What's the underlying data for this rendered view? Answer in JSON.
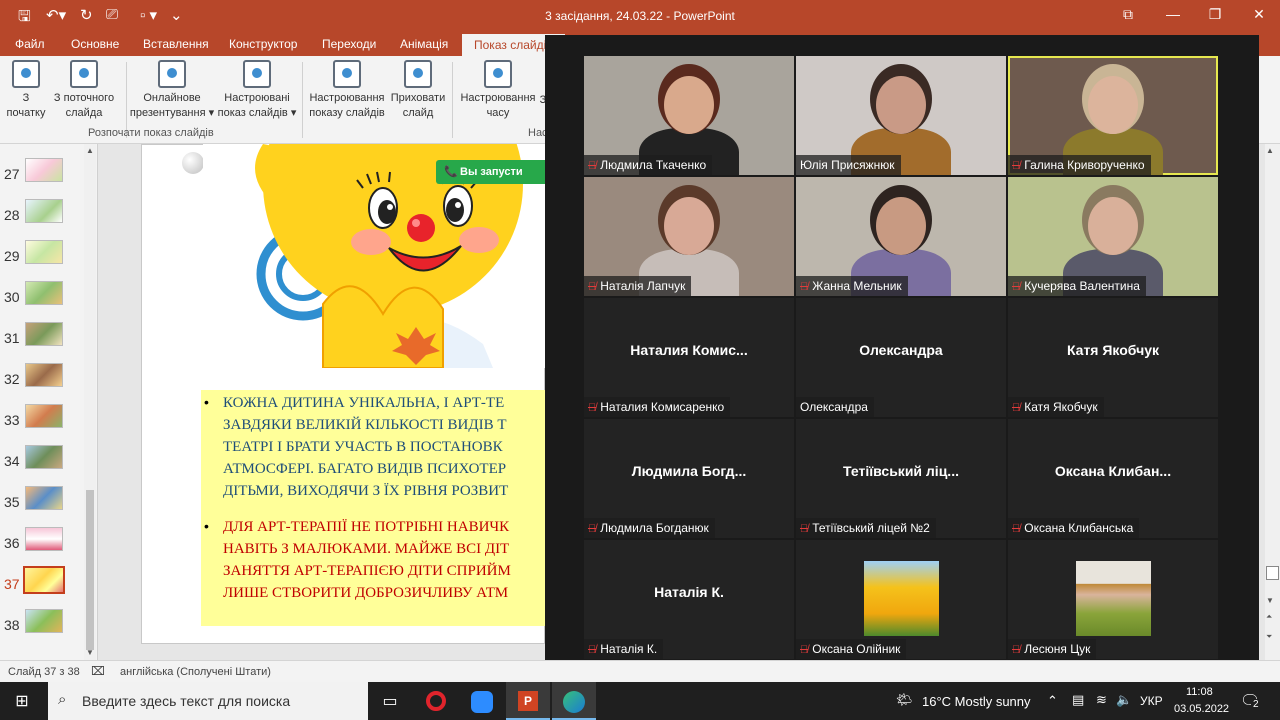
{
  "titlebar": {
    "title": "3 засідання, 24.03.22 - PowerPoint",
    "min": "—",
    "max": "❐",
    "close": "✕",
    "restore": "⧉"
  },
  "ribbon_tabs": [
    "Файл",
    "Основне",
    "Вставлення",
    "Конструктор",
    "Переходи",
    "Анімація",
    "Показ слайдів"
  ],
  "ribbon": {
    "buttons": [
      {
        "line1": "З",
        "line2": "початку"
      },
      {
        "line1": "З поточного",
        "line2": "слайда"
      },
      {
        "line1": "Онлайнове",
        "line2": "презентування ▾"
      },
      {
        "line1": "Настроювані",
        "line2": "показ слайдів ▾"
      },
      {
        "line1": "Настроювання",
        "line2": "показу слайдів"
      },
      {
        "line1": "Приховати",
        "line2": "слайд"
      },
      {
        "line1": "Настроювання",
        "line2": "часу"
      },
      {
        "line1": "З",
        "line2": ""
      }
    ],
    "group1": "Розпочати показ слайдів",
    "group2": "Нас"
  },
  "thumbnails": [
    {
      "num": "27"
    },
    {
      "num": "28"
    },
    {
      "num": "29"
    },
    {
      "num": "30"
    },
    {
      "num": "31"
    },
    {
      "num": "32"
    },
    {
      "num": "33"
    },
    {
      "num": "34"
    },
    {
      "num": "35"
    },
    {
      "num": "36"
    },
    {
      "num": "37"
    },
    {
      "num": "38"
    }
  ],
  "slide": {
    "notice": "Вы запусти",
    "bullets_blue": [
      "КОЖНА ДИТИНА УНІКАЛЬНА, І АРТ-ТЕ",
      "ЗАВДЯКИ ВЕЛИКІЙ КІЛЬКОСТІ ВИДІВ Т",
      "ТЕАТРІ І БРАТИ УЧАСТЬ В ПОСТАНОВК",
      "АТМОСФЕРІ. БАГАТО ВИДІВ ПСИХОТЕР",
      "ДІТЬМИ, ВИХОДЯЧИ З ЇХ РІВНЯ РОЗВИТ"
    ],
    "bullets_red": [
      "ДЛЯ АРТ-ТЕРАПІЇ НЕ ПОТРІБНІ НАВИЧК",
      "НАВІТЬ З МАЛЮКАМИ. МАЙЖЕ ВСІ ДІТ",
      "ЗАНЯТТЯ АРТ-ТЕРАПІЄЮ ДІТИ СПРИЙМ",
      "ЛИШЕ СТВОРИТИ ДОБРОЗИЧЛИВУ АТМ"
    ]
  },
  "zoom": {
    "participants": [
      {
        "name": "Людмила Ткаченко",
        "mic_muted": true,
        "video": true,
        "skin": "#d9a98c",
        "hair": "#5a2a1e",
        "shirt": "#222",
        "bg": "#a9a49c"
      },
      {
        "name": "Юлія Присяжнюк",
        "mic_muted": false,
        "video": true,
        "skin": "#c99a86",
        "hair": "#3a2a24",
        "shirt": "#a26c2c",
        "bg": "#cfc9c6"
      },
      {
        "name": "Галина Криворученко",
        "mic_muted": true,
        "video": true,
        "skin": "#dcb49c",
        "hair": "#c9b595",
        "shirt": "#8c7a2c",
        "bg": "#6e5a4e"
      },
      {
        "name": "Наталія Лапчук",
        "mic_muted": true,
        "video": true,
        "skin": "#d8a996",
        "hair": "#5b3a2a",
        "shirt": "#c6bdb8",
        "bg": "#9a8a7e"
      },
      {
        "name": "Жанна Мельник",
        "mic_muted": true,
        "video": true,
        "skin": "#c89a82",
        "hair": "#2e2420",
        "shirt": "#7b6fa0",
        "bg": "#bdb7ad"
      },
      {
        "name": "Кучерява Валентина",
        "mic_muted": true,
        "video": true,
        "skin": "#d9b09a",
        "hair": "#8a7a60",
        "shirt": "#5a5a6a",
        "bg": "#b9c28e"
      },
      {
        "name": "Наталия Комисаренко",
        "display": "Наталия  Комис...",
        "mic_muted": true,
        "video": false
      },
      {
        "name": "Олександра",
        "display": "Олександра",
        "mic_muted": false,
        "video": false
      },
      {
        "name": "Катя Якобчук",
        "display": "Катя Якобчук",
        "mic_muted": true,
        "video": false
      },
      {
        "name": "Людмила Богданюк",
        "display": "Людмила  Богд...",
        "mic_muted": true,
        "video": false
      },
      {
        "name": "Тетіївський ліцей №2",
        "display": "Тетіївський  ліц...",
        "mic_muted": true,
        "video": false
      },
      {
        "name": "Оксана Клибанська",
        "display": "Оксана  Клибан...",
        "mic_muted": true,
        "video": false
      },
      {
        "name": "Наталія К.",
        "display": "Наталія К.",
        "mic_muted": true,
        "video": false
      },
      {
        "name": "Оксана Олійник",
        "mic_muted": true,
        "video": false,
        "avatar": "tulips"
      },
      {
        "name": "Лесюня Цук",
        "mic_muted": true,
        "video": false,
        "avatar": "portrait"
      }
    ]
  },
  "statusbar": {
    "slide": "Слайд 37 з 38",
    "lang": "англійська (Сполучені Штати)"
  },
  "taskbar": {
    "search_placeholder": "Введите здесь текст для поиска",
    "weather": "16°C  Mostly sunny",
    "lang": "УКР",
    "time": "11:08",
    "date": "03.05.2022",
    "notif_count": "2"
  }
}
